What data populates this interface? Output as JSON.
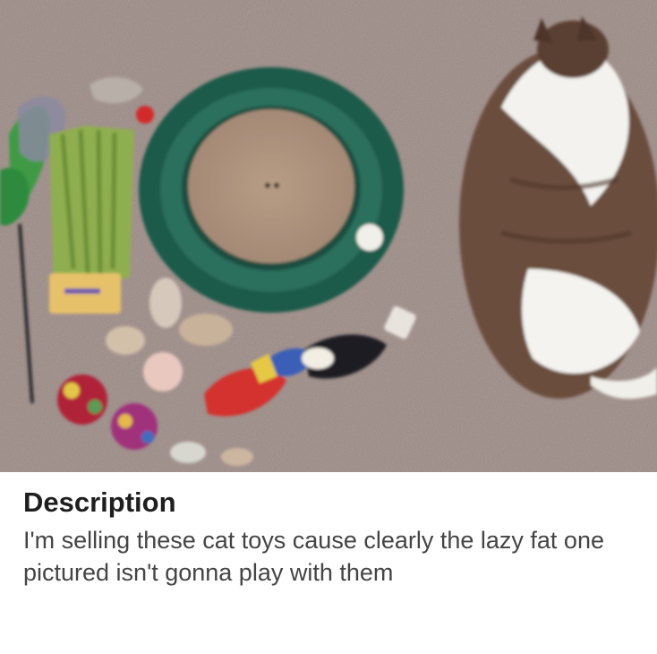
{
  "listing": {
    "photo_icon": "cat-toys-and-cat-photo",
    "description_heading": "Description",
    "description_text": "I'm selling these cat toys cause clearly the lazy fat one pictured isn't gonna play with them"
  }
}
